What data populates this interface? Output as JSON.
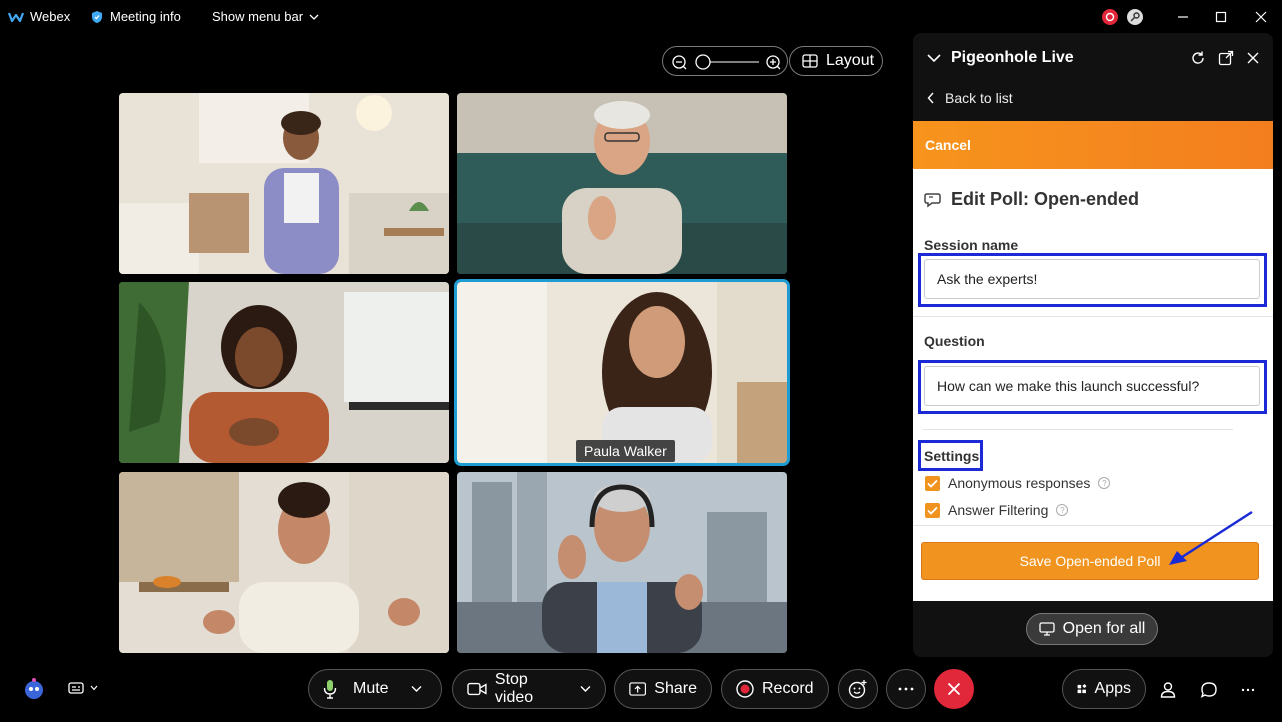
{
  "titlebar": {
    "app_name": "Webex",
    "meeting_info": "Meeting info",
    "show_menu_bar": "Show menu bar"
  },
  "video": {
    "layout_label": "Layout",
    "participants": [
      {
        "name": ""
      },
      {
        "name": ""
      },
      {
        "name": ""
      },
      {
        "name": "Paula Walker"
      },
      {
        "name": ""
      },
      {
        "name": ""
      }
    ]
  },
  "panel": {
    "title": "Pigeonhole Live",
    "back_label": "Back to list",
    "cancel_label": "Cancel",
    "edit_title": "Edit Poll: Open-ended",
    "session_label": "Session name",
    "session_value": "Ask the experts!",
    "question_label": "Question",
    "question_value": "How can we make this launch successful?",
    "settings_label": "Settings",
    "settings": [
      {
        "label": "Anonymous responses",
        "checked": true
      },
      {
        "label": "Answer Filtering",
        "checked": true
      }
    ],
    "save_label": "Save Open-ended Poll",
    "open_all_label": "Open for all"
  },
  "controls": {
    "mute": "Mute",
    "stop_video": "Stop video",
    "share": "Share",
    "record": "Record",
    "apps": "Apps"
  },
  "colors": {
    "accent_orange": "#f0941f",
    "highlight_blue": "#1a2bd6",
    "active_tile": "#1f9cd1",
    "end_red": "#e0283a"
  }
}
